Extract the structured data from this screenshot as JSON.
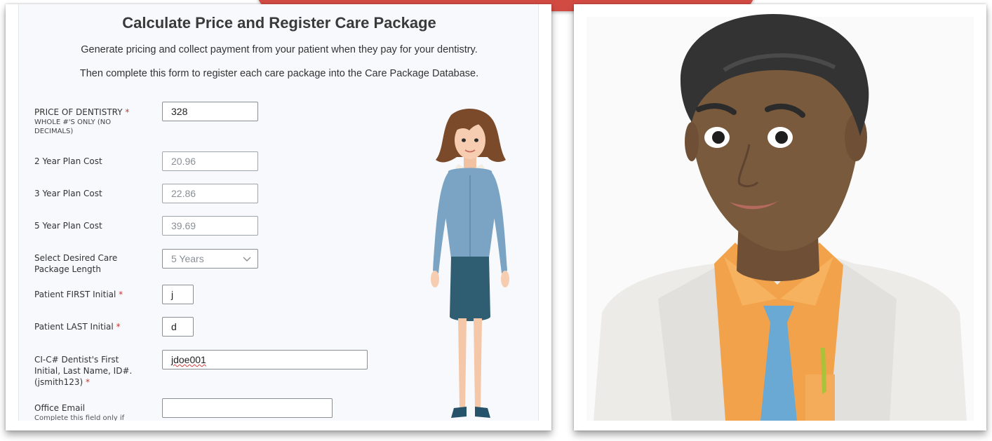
{
  "form": {
    "title": "Calculate Price and Register Care Package",
    "description_1": "Generate pricing and collect payment from your patient when they pay for your dentistry.",
    "description_2": "Then complete this form to register each care package into the Care Package Database.",
    "required_mark": "*",
    "fields": {
      "price": {
        "label": "PRICE OF DENTISTRY",
        "sublabel": "WHOLE #'S ONLY (NO DECIMALS)",
        "value": "328"
      },
      "plan2": {
        "label": "2 Year Plan Cost",
        "value": "20.96"
      },
      "plan3": {
        "label": "3 Year Plan Cost",
        "value": "22.86"
      },
      "plan5": {
        "label": "5 Year Plan Cost",
        "value": "39.69"
      },
      "package_length": {
        "label": "Select Desired Care Package Length",
        "value": "5 Years"
      },
      "first_initial": {
        "label": "Patient FIRST Initial",
        "value": "j"
      },
      "last_initial": {
        "label": "Patient LAST Initial",
        "value": "d"
      },
      "dentist_id": {
        "label": "CI-C# Dentist's First Initial, Last Name, ID#. (jsmith123)",
        "value": "jdoe001"
      },
      "office_email": {
        "label": "Office Email",
        "sublabel": "Complete this field only if",
        "value": ""
      }
    }
  },
  "illustrations": {
    "left": "woman-illustration",
    "right": "doctor-illustration"
  },
  "colors": {
    "banner": "#d24b43",
    "required": "#c23934",
    "form_bg": "#f7f9fc"
  }
}
